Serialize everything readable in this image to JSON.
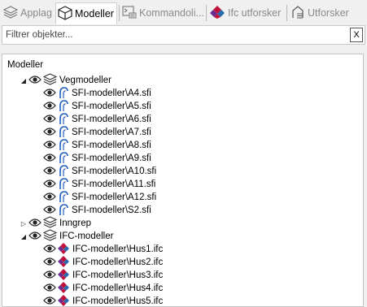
{
  "tabs": [
    {
      "label": "Applag",
      "icon": "layers-icon",
      "active": false
    },
    {
      "label": "Modeller",
      "icon": "cube-icon",
      "active": true
    },
    {
      "label": "Kommandoli...",
      "icon": "command-line-icon",
      "active": false
    },
    {
      "label": "Ifc utforsker",
      "icon": "ifc-icon",
      "active": false
    },
    {
      "label": "Utforsker",
      "icon": "explorer-icon",
      "active": false
    }
  ],
  "filter": {
    "placeholder": "Filtrer objekter...",
    "value": "",
    "clear_label": "X"
  },
  "tree": {
    "root_label": "Modeller",
    "groups": [
      {
        "label": "Vegmodeller",
        "expanded": true,
        "children": [
          "SFI-modeller\\A4.sfi",
          "SFI-modeller\\A5.sfi",
          "SFI-modeller\\A6.sfi",
          "SFI-modeller\\A7.sfi",
          "SFI-modeller\\A8.sfi",
          "SFI-modeller\\A9.sfi",
          "SFI-modeller\\A10.sfi",
          "SFI-modeller\\A11.sfi",
          "SFI-modeller\\A12.sfi",
          "SFI-modeller\\S2.sfi"
        ]
      },
      {
        "label": "Inngrep",
        "expanded": false,
        "children": []
      },
      {
        "label": "IFC-modeller",
        "expanded": true,
        "children": [
          "IFC-modeller\\Hus1.ifc",
          "IFC-modeller\\Hus2.ifc",
          "IFC-modeller\\Hus3.ifc",
          "IFC-modeller\\Hus4.ifc",
          "IFC-modeller\\Hus5.ifc"
        ]
      }
    ]
  },
  "colors": {
    "ifc_red": "#c0143c",
    "ifc_purple": "#6a2c91",
    "ifc_blue": "#2a6ab0",
    "road_blue": "#1f5fbf"
  }
}
